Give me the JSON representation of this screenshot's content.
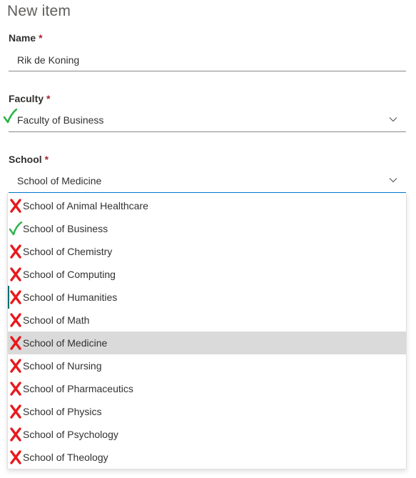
{
  "form": {
    "title": "New item",
    "required_marker": "*"
  },
  "name_field": {
    "label": "Name",
    "value": "Rik de Koning"
  },
  "faculty_field": {
    "label": "Faculty",
    "value": "Faculty of Business",
    "status_icon": "checkmark-icon"
  },
  "school_field": {
    "label": "School",
    "value": "School of Medicine",
    "options": [
      {
        "label": "School of Animal Healthcare",
        "status": "x-icon"
      },
      {
        "label": "School of Business",
        "status": "checkmark-icon"
      },
      {
        "label": "School of Chemistry",
        "status": "x-icon"
      },
      {
        "label": "School of Computing",
        "status": "x-icon"
      },
      {
        "label": "School of Humanities",
        "status": "x-icon"
      },
      {
        "label": "School of Math",
        "status": "x-icon"
      },
      {
        "label": "School of Medicine",
        "status": "x-icon",
        "selected": true
      },
      {
        "label": "School of Nursing",
        "status": "x-icon"
      },
      {
        "label": "School of Pharmaceutics",
        "status": "x-icon"
      },
      {
        "label": "School of Physics",
        "status": "x-icon"
      },
      {
        "label": "School of Psychology",
        "status": "x-icon"
      },
      {
        "label": "School of Theology",
        "status": "x-icon"
      }
    ]
  },
  "colors": {
    "check": "#2db34a",
    "cross": "#e8191c",
    "selected_bg": "#dadada",
    "required": "#a4262c"
  }
}
